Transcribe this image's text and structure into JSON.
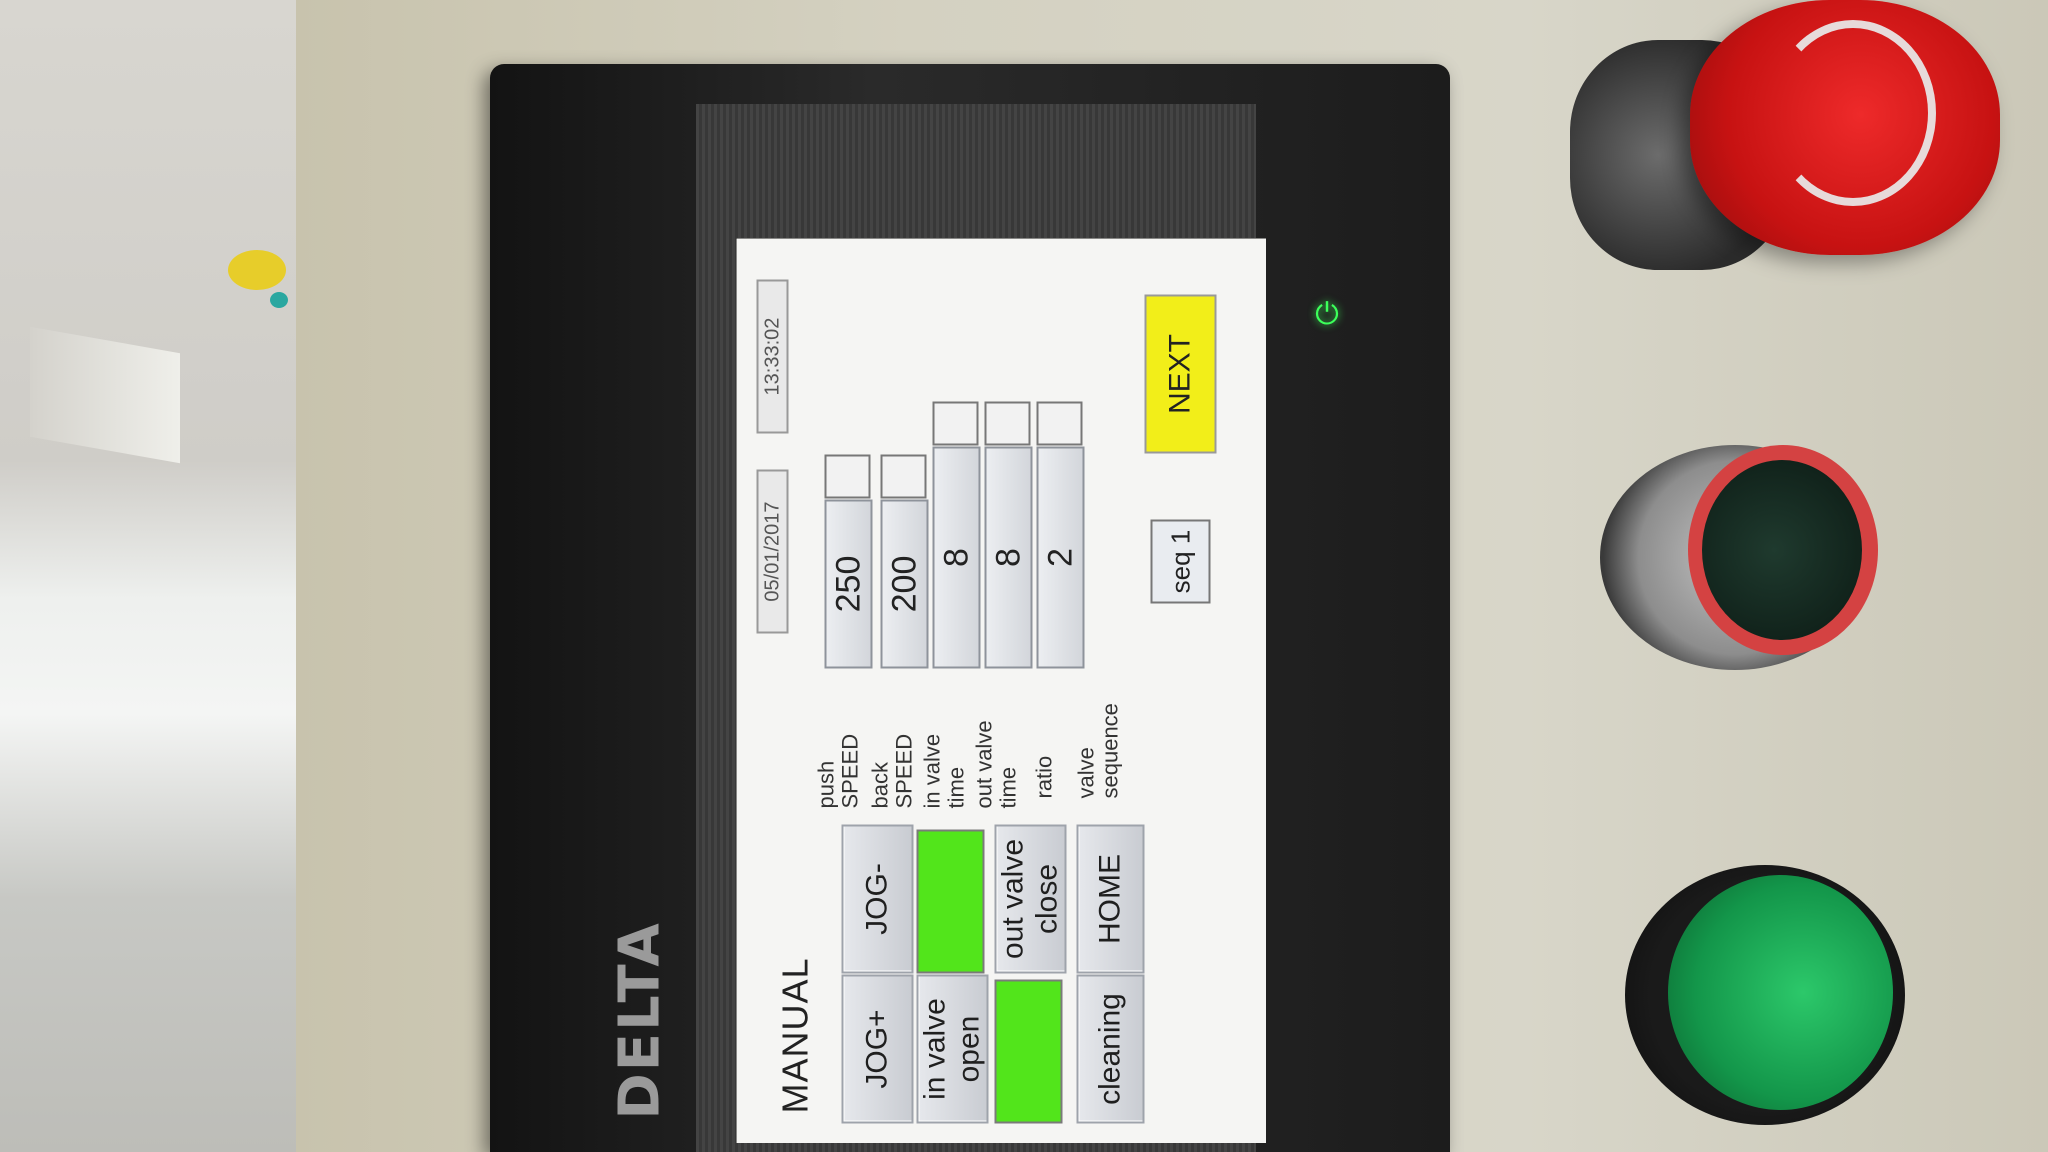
{
  "screen": {
    "title": "MANUAL",
    "date": "05/01/2017",
    "time": "13:33:02"
  },
  "buttons": {
    "jog_plus": "JOG+",
    "jog_minus": "JOG-",
    "in_valve_open": "in valve\nopen",
    "out_valve_close": "out valve\nclose",
    "cleaning": "cleaning",
    "home": "HOME",
    "next": "NEXT"
  },
  "params": [
    {
      "label": "push\nSPEED",
      "value": "250"
    },
    {
      "label": "back\nSPEED",
      "value": "200"
    },
    {
      "label": "in valve\ntime",
      "value": "8"
    },
    {
      "label": "out valve\ntime",
      "value": "8"
    },
    {
      "label": "ratio",
      "value": "2"
    }
  ],
  "valve_sequence": {
    "label": "valve\nsequence",
    "value": "seq 1"
  },
  "brand": "DELTA",
  "colors": {
    "indicator_on": "#52e51b",
    "next_button": "#f2ee19"
  }
}
